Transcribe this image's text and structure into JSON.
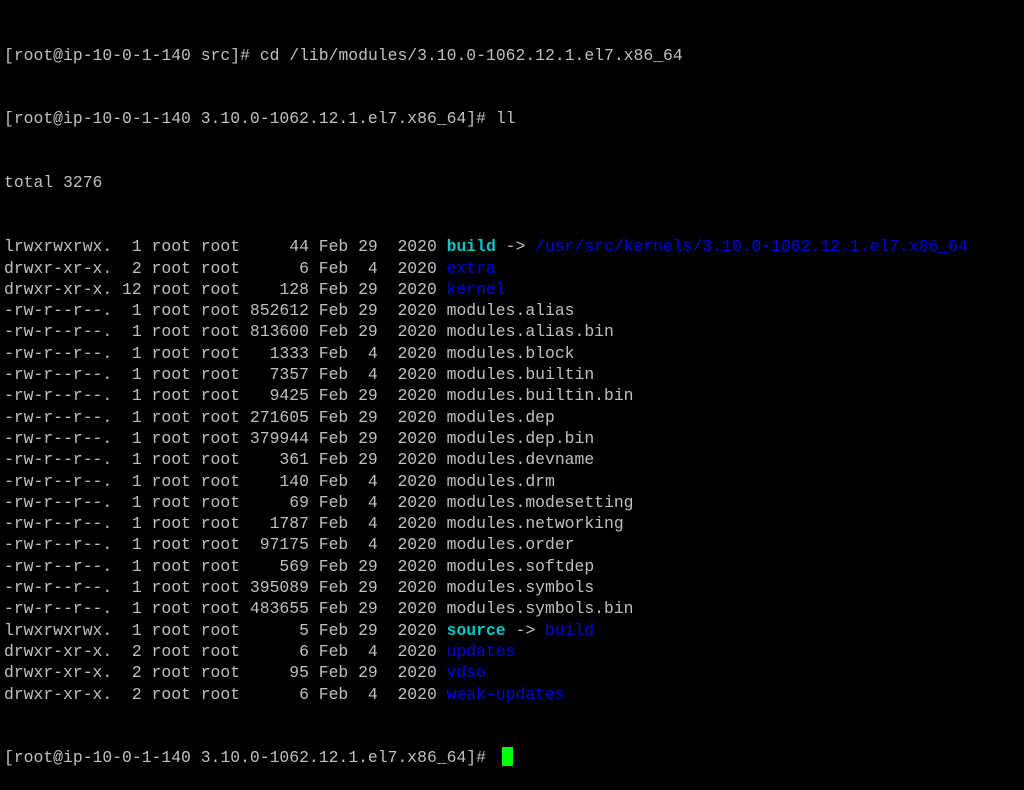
{
  "terminal": {
    "line1": {
      "prompt": "[root@ip-10-0-1-140 src]# ",
      "command": "cd /lib/modules/3.10.0-1062.12.1.el7.x86_64"
    },
    "line2": {
      "prompt": "[root@ip-10-0-1-140 3.10.0-1062.12.1.el7.x86_64]# ",
      "command": "ll"
    },
    "total": "total 3276",
    "entries": [
      {
        "meta": "lrwxrwxrwx.  1 root root     44 Feb 29  2020 ",
        "name": "build",
        "type": "link",
        "arrow": " -> ",
        "target": "/usr/src/kernels/3.10.0-1062.12.1.el7.x86_64",
        "target_type": "dir"
      },
      {
        "meta": "drwxr-xr-x.  2 root root      6 Feb  4  2020 ",
        "name": "extra",
        "type": "dir"
      },
      {
        "meta": "drwxr-xr-x. 12 root root    128 Feb 29  2020 ",
        "name": "kernel",
        "type": "dir"
      },
      {
        "meta": "-rw-r--r--.  1 root root 852612 Feb 29  2020 ",
        "name": "modules.alias",
        "type": "file"
      },
      {
        "meta": "-rw-r--r--.  1 root root 813600 Feb 29  2020 ",
        "name": "modules.alias.bin",
        "type": "file"
      },
      {
        "meta": "-rw-r--r--.  1 root root   1333 Feb  4  2020 ",
        "name": "modules.block",
        "type": "file"
      },
      {
        "meta": "-rw-r--r--.  1 root root   7357 Feb  4  2020 ",
        "name": "modules.builtin",
        "type": "file"
      },
      {
        "meta": "-rw-r--r--.  1 root root   9425 Feb 29  2020 ",
        "name": "modules.builtin.bin",
        "type": "file"
      },
      {
        "meta": "-rw-r--r--.  1 root root 271605 Feb 29  2020 ",
        "name": "modules.dep",
        "type": "file"
      },
      {
        "meta": "-rw-r--r--.  1 root root 379944 Feb 29  2020 ",
        "name": "modules.dep.bin",
        "type": "file"
      },
      {
        "meta": "-rw-r--r--.  1 root root    361 Feb 29  2020 ",
        "name": "modules.devname",
        "type": "file"
      },
      {
        "meta": "-rw-r--r--.  1 root root    140 Feb  4  2020 ",
        "name": "modules.drm",
        "type": "file"
      },
      {
        "meta": "-rw-r--r--.  1 root root     69 Feb  4  2020 ",
        "name": "modules.modesetting",
        "type": "file"
      },
      {
        "meta": "-rw-r--r--.  1 root root   1787 Feb  4  2020 ",
        "name": "modules.networking",
        "type": "file"
      },
      {
        "meta": "-rw-r--r--.  1 root root  97175 Feb  4  2020 ",
        "name": "modules.order",
        "type": "file"
      },
      {
        "meta": "-rw-r--r--.  1 root root    569 Feb 29  2020 ",
        "name": "modules.softdep",
        "type": "file"
      },
      {
        "meta": "-rw-r--r--.  1 root root 395089 Feb 29  2020 ",
        "name": "modules.symbols",
        "type": "file"
      },
      {
        "meta": "-rw-r--r--.  1 root root 483655 Feb 29  2020 ",
        "name": "modules.symbols.bin",
        "type": "file"
      },
      {
        "meta": "lrwxrwxrwx.  1 root root      5 Feb 29  2020 ",
        "name": "source",
        "type": "link",
        "arrow": " -> ",
        "target": "build",
        "target_type": "dir"
      },
      {
        "meta": "drwxr-xr-x.  2 root root      6 Feb  4  2020 ",
        "name": "updates",
        "type": "dir"
      },
      {
        "meta": "drwxr-xr-x.  2 root root     95 Feb 29  2020 ",
        "name": "vdso",
        "type": "dir"
      },
      {
        "meta": "drwxr-xr-x.  2 root root      6 Feb  4  2020 ",
        "name": "weak-updates",
        "type": "dir"
      }
    ],
    "final_prompt": "[root@ip-10-0-1-140 3.10.0-1062.12.1.el7.x86_64]# ",
    "colors": {
      "background": "#000000",
      "text": "#c0c0c0",
      "directory": "#0000e8",
      "symlink": "#00c8c8",
      "cursor": "#00ff00"
    }
  }
}
